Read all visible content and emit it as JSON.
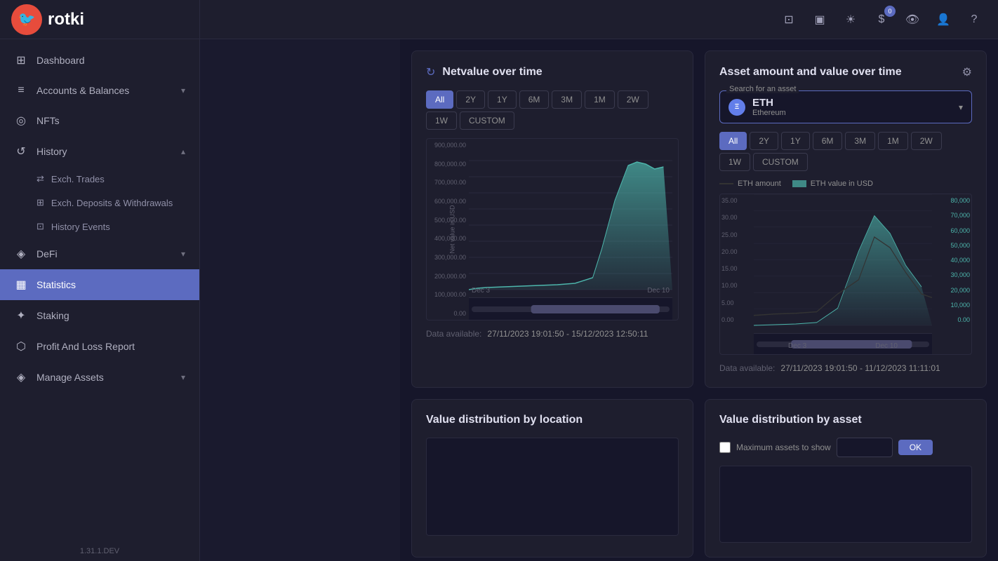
{
  "sidebar": {
    "logo": {
      "icon": "🐦",
      "text": "rotki"
    },
    "nav": [
      {
        "id": "dashboard",
        "label": "Dashboard",
        "icon": "⊞",
        "hasChildren": false,
        "active": false
      },
      {
        "id": "accounts-balances",
        "label": "Accounts & Balances",
        "icon": "≡",
        "hasChildren": true,
        "active": false
      },
      {
        "id": "nfts",
        "label": "NFTs",
        "icon": "◎",
        "hasChildren": false,
        "active": false
      },
      {
        "id": "history",
        "label": "History",
        "icon": "↺",
        "hasChildren": true,
        "active": false,
        "expanded": true
      },
      {
        "id": "defi",
        "label": "DeFi",
        "icon": "◈",
        "hasChildren": true,
        "active": false
      },
      {
        "id": "statistics",
        "label": "Statistics",
        "icon": "▦",
        "hasChildren": false,
        "active": true
      },
      {
        "id": "staking",
        "label": "Staking",
        "icon": "✦",
        "hasChildren": false,
        "active": false
      },
      {
        "id": "profit-loss",
        "label": "Profit And Loss Report",
        "icon": "⬡",
        "hasChildren": false,
        "active": false
      },
      {
        "id": "manage-assets",
        "label": "Manage Assets",
        "icon": "◈",
        "hasChildren": true,
        "active": false
      }
    ],
    "historyChildren": [
      {
        "id": "exch-trades",
        "label": "Exch. Trades",
        "icon": "⇄"
      },
      {
        "id": "exch-deposits",
        "label": "Exch. Deposits & Withdrawals",
        "icon": "⊞"
      },
      {
        "id": "history-events",
        "label": "History Events",
        "icon": "⊡"
      }
    ],
    "version": "1.31.1.DEV"
  },
  "topbar": {
    "buttons": [
      {
        "id": "screenshot",
        "icon": "⊡",
        "label": "screenshot"
      },
      {
        "id": "template",
        "icon": "▣",
        "label": "template"
      },
      {
        "id": "theme",
        "icon": "☀",
        "label": "theme"
      },
      {
        "id": "currency",
        "icon": "$",
        "label": "currency",
        "badge": "0"
      },
      {
        "id": "eye",
        "icon": "👁",
        "label": "eye"
      },
      {
        "id": "user",
        "icon": "👤",
        "label": "user"
      },
      {
        "id": "help",
        "icon": "?",
        "label": "help"
      }
    ]
  },
  "netvalue": {
    "title": "Netvalue over time",
    "timeFilters": [
      "All",
      "2Y",
      "1Y",
      "6M",
      "3M",
      "1M",
      "2W",
      "1W",
      "CUSTOM"
    ],
    "activeFilter": "All",
    "yLabels": [
      "900,000.00",
      "800,000.00",
      "700,000.00",
      "600,000.00",
      "500,000.00",
      "400,000.00",
      "300,000.00",
      "200,000.00",
      "100,000.00",
      "0.00"
    ],
    "xLabels": [
      "Dec 3",
      "Dec 10"
    ],
    "yAxisLabel": "Net value in USD",
    "dataAvailableLabel": "Data available:",
    "dataAvailableValue": "27/11/2023 19:01:50 - 15/12/2023 12:50:11"
  },
  "assetChart": {
    "title": "Asset amount and value over time",
    "searchPlaceholder": "Search for an asset",
    "asset": {
      "symbol": "ETH",
      "name": "Ethereum",
      "icon": "Ξ"
    },
    "timeFilters": [
      "All",
      "2Y",
      "1Y",
      "6M",
      "3M",
      "1M",
      "2W",
      "1W",
      "CUSTOM"
    ],
    "activeFilter": "All",
    "legend": [
      {
        "label": "ETH amount",
        "type": "line"
      },
      {
        "label": "ETH value in USD",
        "type": "area"
      }
    ],
    "leftYLabels": [
      "35.00",
      "30.00",
      "25.00",
      "20.00",
      "15.00",
      "10.00",
      "5.00",
      "0.00"
    ],
    "rightYLabels": [
      "80,000",
      "70,000",
      "60,000",
      "50,000",
      "40,000",
      "30,000",
      "20,000",
      "10,000",
      "0.00"
    ],
    "xLabels": [
      "Dec 3",
      "Dec 10"
    ],
    "dataAvailableLabel": "Data available:",
    "dataAvailableValue": "27/11/2023 19:01:50 - 11/12/2023 11:11:01"
  },
  "valueByLocation": {
    "title": "Value distribution by location"
  },
  "valueByAsset": {
    "title": "Value distribution by asset",
    "maxAssetsLabel": "Maximum assets to show"
  }
}
